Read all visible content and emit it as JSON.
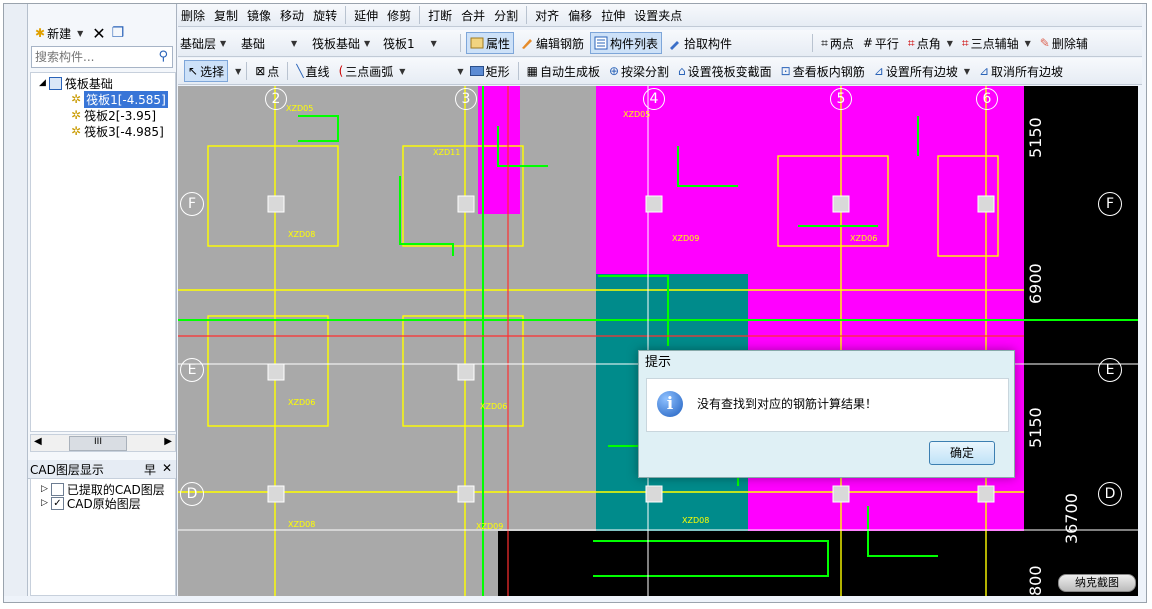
{
  "toolbar_top": {
    "items": [
      "删除",
      "复制",
      "镜像",
      "移动",
      "旋转",
      "延伸",
      "修剪",
      "打断",
      "合并",
      "分割",
      "对齐",
      "偏移",
      "拉伸",
      "设置夹点"
    ]
  },
  "toolbar_props": {
    "floor": "基础层",
    "category": "基础",
    "type": "筏板基础",
    "element": "筏板1",
    "properties_btn": "属性",
    "edit_rebar_btn": "编辑钢筋",
    "component_list_btn": "构件列表",
    "pick_component_btn": "拾取构件",
    "two_points_btn": "两点",
    "parallel_btn": "平行",
    "point_angle_btn": "点角",
    "three_point_axis_btn": "三点辅轴",
    "delete_axis_btn": "删除辅"
  },
  "toolbar_draw": {
    "select_btn": "选择",
    "point_btn": "点",
    "line_btn": "直线",
    "arc_btn": "三点画弧",
    "rect_btn": "矩形",
    "auto_slab_btn": "自动生成板",
    "split_by_beam_btn": "按梁分割",
    "set_section_btn": "设置筏板变截面",
    "view_rebar_btn": "查看板内钢筋",
    "set_slopes_btn": "设置所有边坡",
    "cancel_slopes_btn": "取消所有边坡"
  },
  "left_panel": {
    "new_btn": "新建",
    "search_placeholder": "搜索构件...",
    "tree_root": "筏板基础",
    "tree_items": [
      "筏板1[-4.585]",
      "筏板2[-3.95]",
      "筏板3[-4.985]"
    ],
    "scroll_label": "III",
    "layer_panel_title": "CAD图层显示",
    "layer_pin": "早",
    "layers": [
      {
        "label": "已提取的CAD图层",
        "checked": false
      },
      {
        "label": "CAD原始图层",
        "checked": true
      }
    ]
  },
  "canvas": {
    "axis_top": [
      "2",
      "3",
      "4",
      "5",
      "6"
    ],
    "axis_right": [
      "F",
      "E",
      "D"
    ],
    "axis_left": [
      "F",
      "E",
      "D"
    ],
    "dims": [
      "5150",
      "6900",
      "5150",
      "36700",
      "800"
    ],
    "labels": [
      "XZD05",
      "XZD11",
      "XZD08",
      "XZD05",
      "XZD06",
      "XZD08",
      "XZD09",
      "XZD08",
      "XZD06",
      "XZD09",
      "XZD06"
    ],
    "capture_label": "纳克截图"
  },
  "dialog": {
    "title": "提示",
    "message": "没有查找到对应的钢筋计算结果！",
    "ok_label": "确定"
  },
  "colors": {
    "magenta": "#ff00ff",
    "teal": "#008b8b",
    "grey": "#a9a9a9"
  }
}
